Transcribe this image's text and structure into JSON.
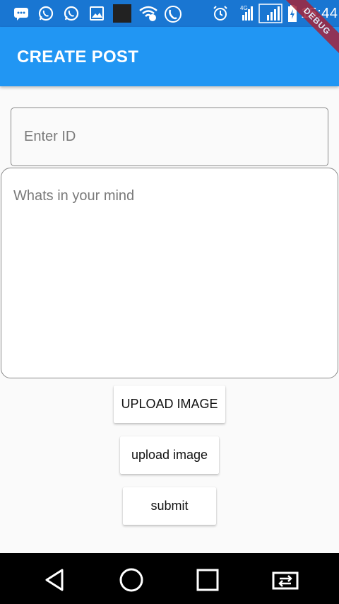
{
  "status_bar": {
    "time": "15:44",
    "network_label": "4G",
    "debug_label": "DEBUG",
    "icons": [
      "message-icon",
      "whatsapp-icon",
      "whatsapp-icon",
      "image-icon",
      "app-thumbnail-icon",
      "wifi-icon",
      "phone-icon",
      "alarm-icon",
      "signal-icon",
      "signal-icon",
      "battery-icon"
    ]
  },
  "app_bar": {
    "title": "CREATE POST"
  },
  "form": {
    "id_placeholder": "Enter ID",
    "post_placeholder": "Whats in your mind"
  },
  "buttons": {
    "upload_primary": "UPLOAD IMAGE",
    "upload_secondary": "upload image",
    "submit": "submit"
  },
  "nav_bar": {
    "icons": [
      "back-icon",
      "home-icon",
      "recents-icon",
      "screen-switch-icon"
    ]
  },
  "colors": {
    "status_bar": "#1976D2",
    "app_bar": "#2196F3",
    "background": "#fafafa",
    "debug_banner": "#a3243b"
  }
}
